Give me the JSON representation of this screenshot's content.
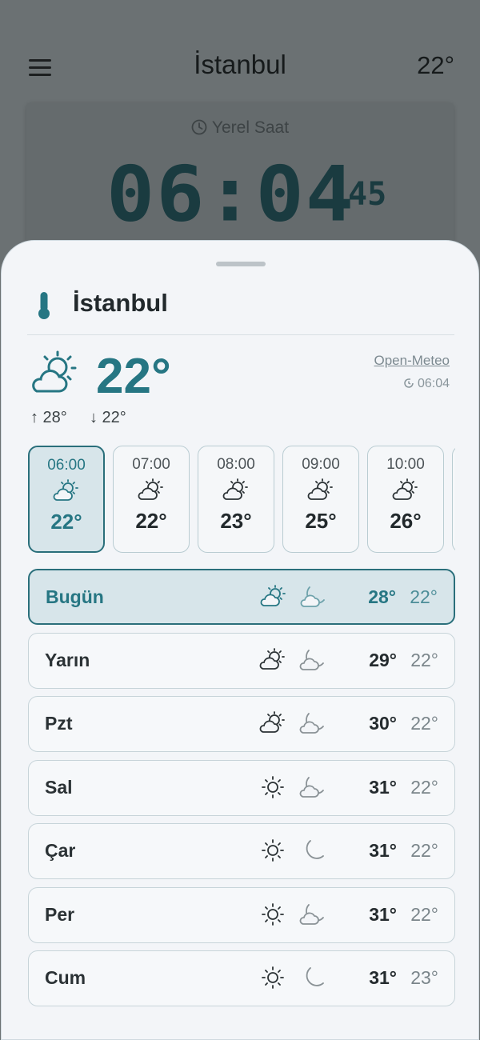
{
  "header": {
    "city": "İstanbul",
    "temp": "22°"
  },
  "clock": {
    "label": "Yerel Saat",
    "time": "06:04",
    "seconds": "45"
  },
  "sheet": {
    "city": "İstanbul",
    "current": {
      "temp": "22°",
      "high": "↑ 28°",
      "low": "↓ 22°",
      "icon": "partly-sunny-icon"
    },
    "source": "Open-Meteo",
    "updated": "06:04"
  },
  "hourly": [
    {
      "time": "06:00",
      "temp": "22°",
      "icon": "partly-sunny-icon"
    },
    {
      "time": "07:00",
      "temp": "22°",
      "icon": "partly-sunny-icon"
    },
    {
      "time": "08:00",
      "temp": "23°",
      "icon": "partly-sunny-icon"
    },
    {
      "time": "09:00",
      "temp": "25°",
      "icon": "partly-sunny-icon"
    },
    {
      "time": "10:00",
      "temp": "26°",
      "icon": "partly-sunny-icon"
    }
  ],
  "daily": [
    {
      "name": "Bugün",
      "high": "28°",
      "low": "22°",
      "day_icon": "partly-sunny-icon",
      "night_icon": "partly-cloudy-night-icon"
    },
    {
      "name": "Yarın",
      "high": "29°",
      "low": "22°",
      "day_icon": "partly-sunny-icon",
      "night_icon": "partly-cloudy-night-icon"
    },
    {
      "name": "Pzt",
      "high": "30°",
      "low": "22°",
      "day_icon": "partly-sunny-icon",
      "night_icon": "partly-cloudy-night-icon"
    },
    {
      "name": "Sal",
      "high": "31°",
      "low": "22°",
      "day_icon": "sun-icon",
      "night_icon": "partly-cloudy-night-icon"
    },
    {
      "name": "Çar",
      "high": "31°",
      "low": "22°",
      "day_icon": "sun-icon",
      "night_icon": "moon-icon"
    },
    {
      "name": "Per",
      "high": "31°",
      "low": "22°",
      "day_icon": "sun-icon",
      "night_icon": "partly-cloudy-night-icon"
    },
    {
      "name": "Cum",
      "high": "31°",
      "low": "23°",
      "day_icon": "sun-icon",
      "night_icon": "moon-icon"
    }
  ],
  "colors": {
    "accent": "#267683",
    "selected_bg": "#d7e5ea",
    "sheet_bg": "#f3f5f8"
  }
}
